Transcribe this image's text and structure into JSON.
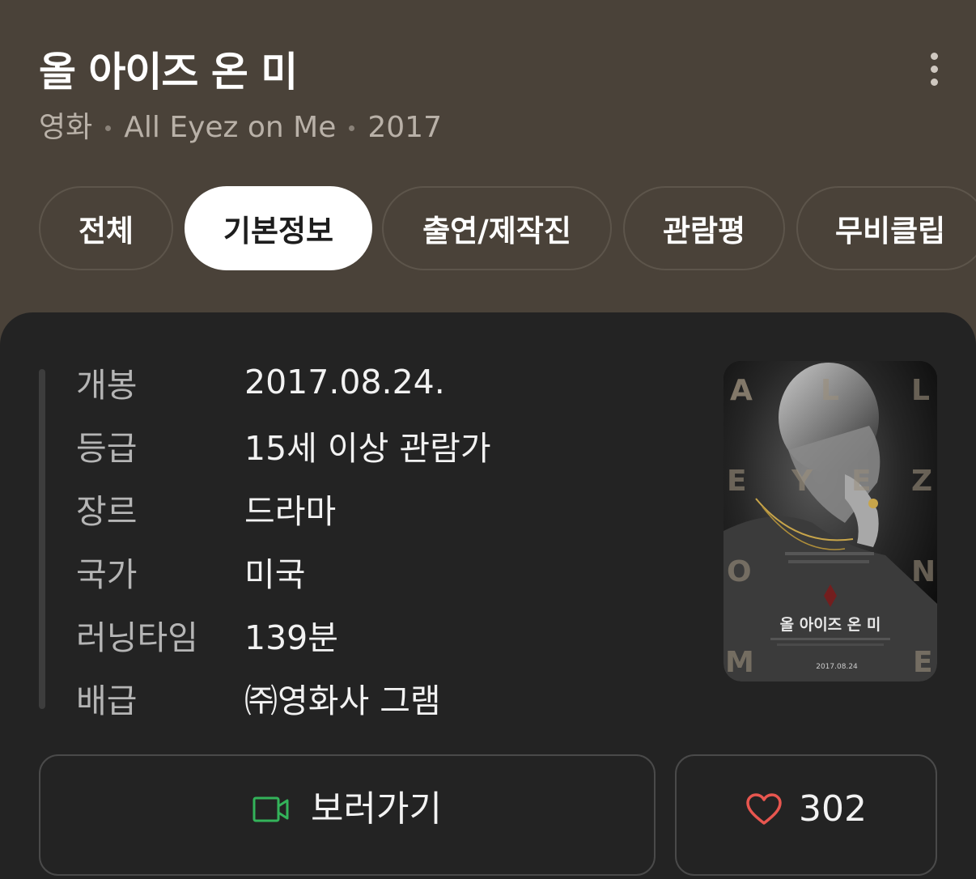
{
  "header": {
    "title": "올 아이즈 온 미",
    "meta": [
      "영화",
      "All Eyez on Me",
      "2017"
    ]
  },
  "tabs": [
    {
      "label": "전체",
      "active": false
    },
    {
      "label": "기본정보",
      "active": true
    },
    {
      "label": "출연/제작진",
      "active": false
    },
    {
      "label": "관람평",
      "active": false
    },
    {
      "label": "무비클립",
      "active": false
    }
  ],
  "info": [
    {
      "label": "개봉",
      "value": "2017.08.24."
    },
    {
      "label": "등급",
      "value": "15세 이상 관람가"
    },
    {
      "label": "장르",
      "value": "드라마"
    },
    {
      "label": "국가",
      "value": "미국"
    },
    {
      "label": "러닝타임",
      "value": "139분"
    },
    {
      "label": "배급",
      "value": "㈜영화사 그램"
    }
  ],
  "poster": {
    "title_text": "올 아이즈 온 미",
    "release_text": "2017.08.24",
    "letters": [
      "A",
      "L",
      "L",
      "E",
      "Y",
      "E",
      "Z",
      "O",
      "N",
      "M",
      "E"
    ]
  },
  "actions": {
    "watch_label": "보러가기",
    "watch_icon": "video-camera-icon",
    "like_count": "302",
    "like_icon": "heart-icon"
  },
  "colors": {
    "header_bg": "#4a4239",
    "card_bg": "#232323",
    "watch_icon": "#33b35a",
    "heart_icon": "#e8564f"
  }
}
